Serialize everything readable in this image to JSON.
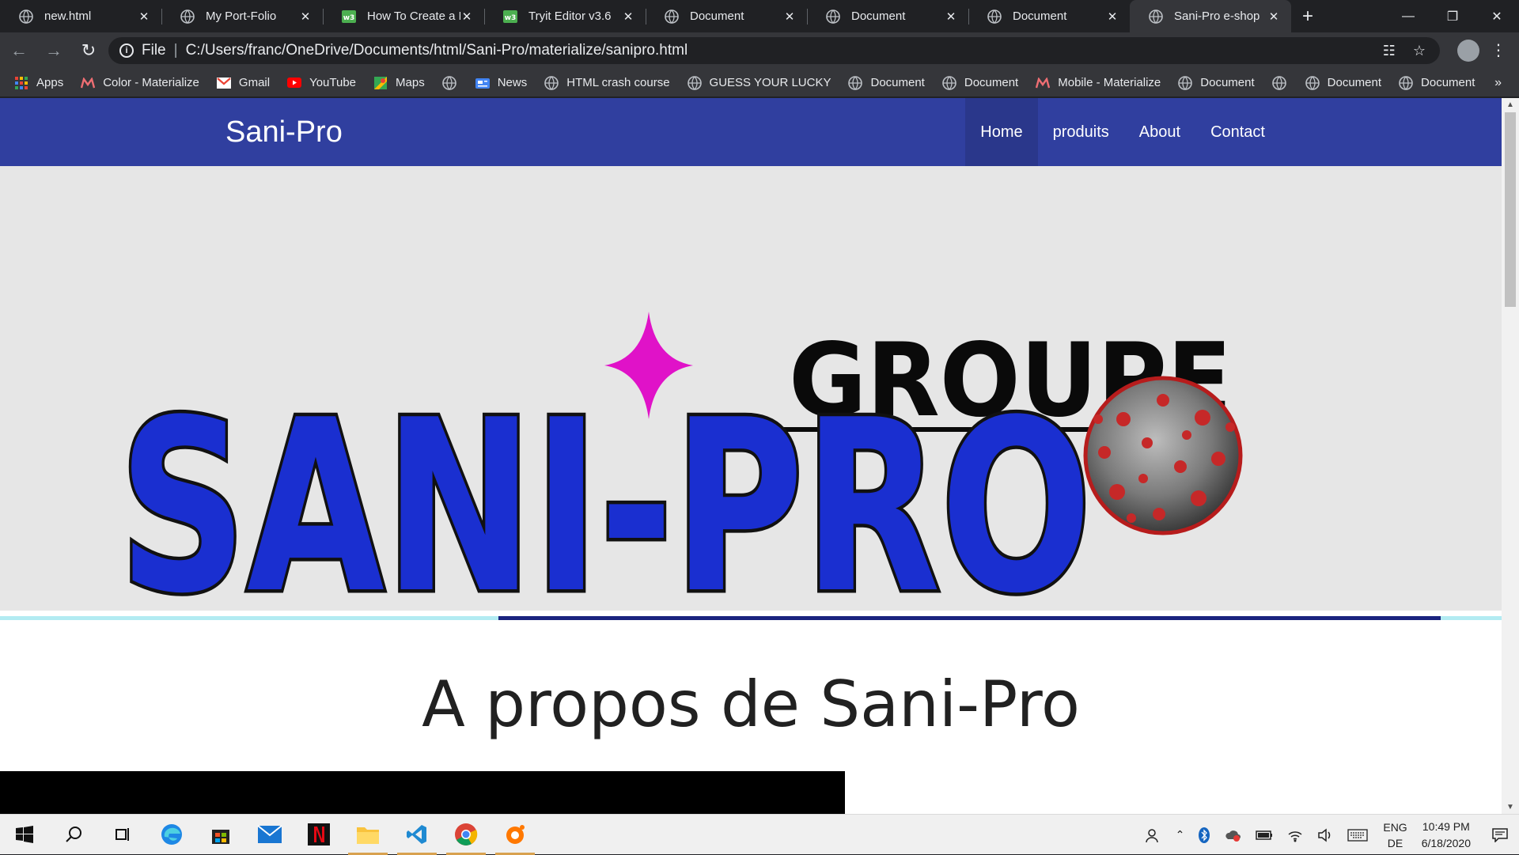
{
  "browser": {
    "tabs": [
      {
        "title": "new.html",
        "icon": "globe-icon",
        "active": false
      },
      {
        "title": "My Port-Folio",
        "icon": "globe-icon",
        "active": false
      },
      {
        "title": "How To Create a P",
        "icon": "w3-icon",
        "active": false
      },
      {
        "title": "Tryit Editor v3.6",
        "icon": "w3-icon",
        "active": false
      },
      {
        "title": "Document",
        "icon": "globe-icon",
        "active": false
      },
      {
        "title": "Document",
        "icon": "globe-icon",
        "active": false
      },
      {
        "title": "Document",
        "icon": "globe-icon",
        "active": false
      },
      {
        "title": "Sani-Pro e-shop",
        "icon": "globe-icon",
        "active": true
      }
    ],
    "address": {
      "scheme_label": "File",
      "url": "C:/Users/franc/OneDrive/Documents/html/Sani-Pro/materialize/sanipro.html"
    },
    "bookmarks": [
      {
        "label": "Apps",
        "icon": "apps-grid-icon"
      },
      {
        "label": "Color - Materialize",
        "icon": "materialize-icon"
      },
      {
        "label": "Gmail",
        "icon": "gmail-icon"
      },
      {
        "label": "YouTube",
        "icon": "youtube-icon"
      },
      {
        "label": "Maps",
        "icon": "maps-icon"
      },
      {
        "label": "",
        "icon": "globe-icon"
      },
      {
        "label": "News",
        "icon": "news-icon"
      },
      {
        "label": "HTML crash course",
        "icon": "globe-icon"
      },
      {
        "label": "GUESS YOUR LUCKY",
        "icon": "globe-icon"
      },
      {
        "label": "Document",
        "icon": "globe-icon"
      },
      {
        "label": "Document",
        "icon": "globe-icon"
      },
      {
        "label": "Mobile - Materialize",
        "icon": "materialize-icon"
      },
      {
        "label": "Document",
        "icon": "globe-icon"
      },
      {
        "label": "",
        "icon": "globe-icon"
      },
      {
        "label": "Document",
        "icon": "globe-icon"
      },
      {
        "label": "Document",
        "icon": "globe-icon"
      }
    ],
    "bookmarks_more": "»"
  },
  "page": {
    "brand": "Sani-Pro",
    "nav": [
      {
        "label": "Home",
        "active": true
      },
      {
        "label": "produits",
        "active": false
      },
      {
        "label": "About",
        "active": false
      },
      {
        "label": "Contact",
        "active": false
      }
    ],
    "logo": {
      "top_word": "GROUPE",
      "main_word": "SANI-PRO"
    },
    "section_title": "A propos de Sani-Pro",
    "colors": {
      "navbar": "#303f9f",
      "hero_bg": "#e6e6e6",
      "logo_blue": "#1a2fd0",
      "star": "#e012c8",
      "divider_light": "#b2ebf2",
      "divider_dark": "#1a237e"
    }
  },
  "taskbar": {
    "apps": [
      "windows-start-icon",
      "search-icon",
      "task-view-icon",
      "edge-icon",
      "store-icon",
      "mail-icon",
      "netflix-icon",
      "file-explorer-icon",
      "vscode-icon",
      "chrome-icon",
      "avast-icon"
    ],
    "lang_top": "ENG",
    "lang_bottom": "DE",
    "time": "10:49 PM",
    "date": "6/18/2020"
  }
}
